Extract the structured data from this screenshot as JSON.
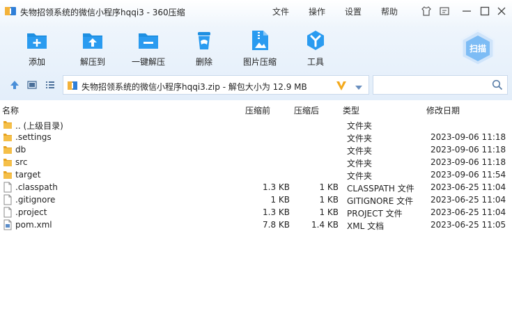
{
  "window": {
    "title": "失物招领系统的微信小程序hqqi3 - 360压缩",
    "menu": [
      "文件",
      "操作",
      "设置",
      "帮助"
    ]
  },
  "toolbar": {
    "buttons": [
      "添加",
      "解压到",
      "一键解压",
      "删除",
      "图片压缩",
      "工具"
    ],
    "scan_label": "扫描"
  },
  "address": {
    "path": "失物招领系统的微信小程序hqqi3.zip - 解包大小为 12.9 MB",
    "search_placeholder": ""
  },
  "columns": [
    "名称",
    "压缩前",
    "压缩后",
    "类型",
    "修改日期"
  ],
  "files": [
    {
      "name": ".. (上级目录)",
      "original": "",
      "compressed": "",
      "type": "文件夹",
      "modified": "",
      "icon": "folder-icon"
    },
    {
      "name": ".settings",
      "original": "",
      "compressed": "",
      "type": "文件夹",
      "modified": "2023-09-06 11:18",
      "icon": "folder-icon"
    },
    {
      "name": "db",
      "original": "",
      "compressed": "",
      "type": "文件夹",
      "modified": "2023-09-06 11:18",
      "icon": "folder-icon"
    },
    {
      "name": "src",
      "original": "",
      "compressed": "",
      "type": "文件夹",
      "modified": "2023-09-06 11:18",
      "icon": "folder-icon"
    },
    {
      "name": "target",
      "original": "",
      "compressed": "",
      "type": "文件夹",
      "modified": "2023-09-06 11:54",
      "icon": "folder-icon"
    },
    {
      "name": ".classpath",
      "original": "1.3 KB",
      "compressed": "1 KB",
      "type": "CLASSPATH 文件",
      "modified": "2023-06-25 11:04",
      "icon": "file-icon"
    },
    {
      "name": ".gitignore",
      "original": "1 KB",
      "compressed": "1 KB",
      "type": "GITIGNORE 文件",
      "modified": "2023-06-25 11:04",
      "icon": "file-icon"
    },
    {
      "name": ".project",
      "original": "1.3 KB",
      "compressed": "1 KB",
      "type": "PROJECT 文件",
      "modified": "2023-06-25 11:04",
      "icon": "file-icon"
    },
    {
      "name": "pom.xml",
      "original": "7.8 KB",
      "compressed": "1.4 KB",
      "type": "XML 文档",
      "modified": "2023-06-25 11:05",
      "icon": "xml-file-icon"
    }
  ],
  "colors": {
    "accent": "#1e8fe1",
    "folder": "#f2b33d",
    "header_bg": "#e6f0fb"
  }
}
